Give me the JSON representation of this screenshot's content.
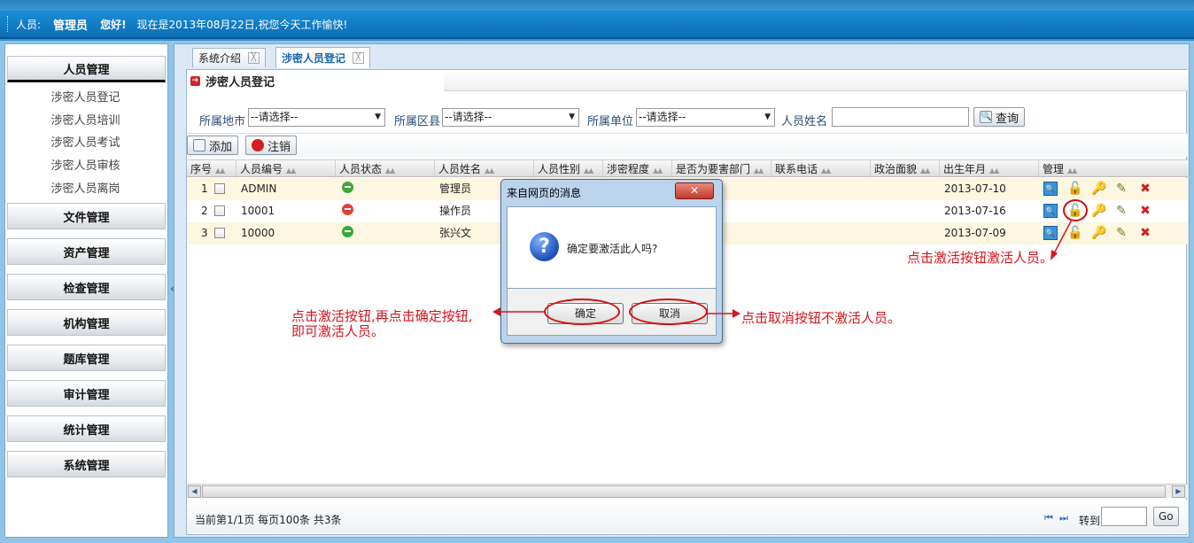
{
  "header": {
    "user_label": "人员:",
    "user_name": "管理员",
    "greeting": "您好!",
    "date_text": "现在是2013年08月22日,祝您今天工作愉快!"
  },
  "sidebar": {
    "groups": [
      {
        "label": "人员管理"
      },
      {
        "label": "文件管理"
      },
      {
        "label": "资产管理"
      },
      {
        "label": "检查管理"
      },
      {
        "label": "机构管理"
      },
      {
        "label": "题库管理"
      },
      {
        "label": "审计管理"
      },
      {
        "label": "统计管理"
      },
      {
        "label": "系统管理"
      }
    ],
    "sub_items": [
      "涉密人员登记",
      "涉密人员培训",
      "涉密人员考试",
      "涉密人员审核",
      "涉密人员离岗"
    ]
  },
  "tabs": [
    {
      "label": "系统介绍",
      "close": "╳"
    },
    {
      "label": "涉密人员登记",
      "close": "╳"
    }
  ],
  "section_title": "涉密人员登记",
  "filters": {
    "city_label": "所属地市",
    "city_value": "--请选择--",
    "district_label": "所属区县",
    "district_value": "--请选择--",
    "unit_label": "所属单位",
    "unit_value": "--请选择--",
    "name_label": "人员姓名",
    "name_value": "",
    "search_button": "查询"
  },
  "toolbar": {
    "add_button": "添加",
    "cancel_button": "注销"
  },
  "grid": {
    "columns": [
      "序号",
      "人员编号",
      "人员状态",
      "人员姓名",
      "人员性别",
      "涉密程度",
      "是否为要害部门",
      "联系电话",
      "政治面貌",
      "出生年月",
      "管理"
    ],
    "rows": [
      {
        "index": "1",
        "code": "ADMIN",
        "status_color": "#3aa83a",
        "name": "管理员",
        "birth": "2013-07-10"
      },
      {
        "index": "2",
        "code": "10001",
        "status_color": "#e0403a",
        "name": "操作员",
        "birth": "2013-07-16"
      },
      {
        "index": "3",
        "code": "10000",
        "status_color": "#3aa83a",
        "name": "张兴文",
        "birth": "2013-07-09"
      }
    ]
  },
  "pager": {
    "info": "当前第1/1页 每页100条 共3条",
    "first": "⏮",
    "last": "⏭",
    "goto_label": "转到",
    "goto_value": "",
    "go_button": "Go"
  },
  "dialog": {
    "title": "来自网页的消息",
    "close": "✕",
    "message": "确定要激活此人吗?",
    "icon": "?",
    "ok": "确定",
    "cancel": "取消"
  },
  "annotations": {
    "left_line1": "点击激活按钮,再点击确定按钮,",
    "left_line2": "即可激活人员。",
    "right": "点击取消按钮不激活人员。",
    "top_right": "点击激活按钮激活人员。"
  },
  "colors": {
    "annotation": "#d9141c",
    "header": "#0b6db4",
    "active_tab": "#1a64a8"
  }
}
